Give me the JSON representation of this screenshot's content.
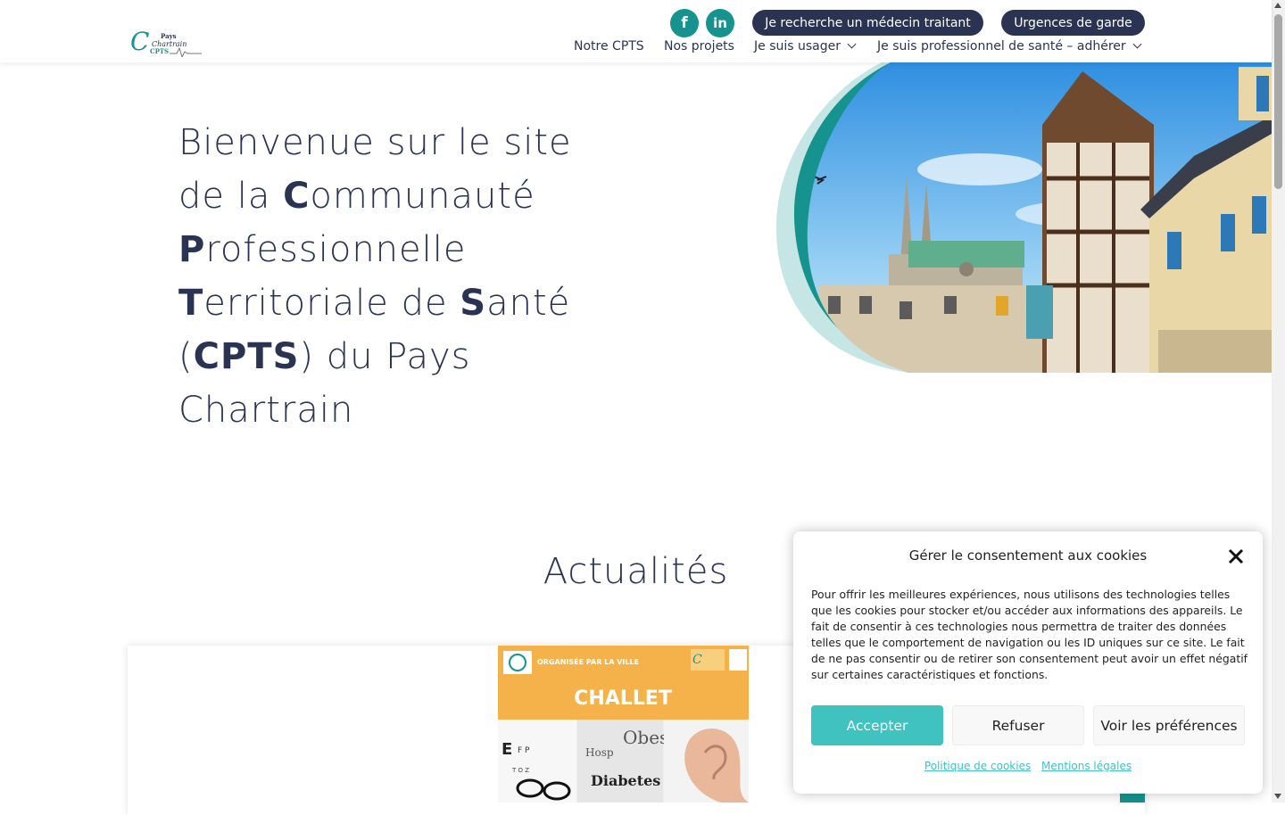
{
  "header": {
    "logo": {
      "text_top": "Pays",
      "text_mid": "Chartrain",
      "text_letters": "CPTS"
    },
    "social": [
      {
        "icon": "facebook-icon",
        "glyph": "f"
      },
      {
        "icon": "linkedin-icon",
        "glyph": "in"
      }
    ],
    "cta": {
      "medecin": "Je recherche un médecin traitant",
      "urgences": "Urgences de garde"
    },
    "nav": {
      "notre": "Notre CPTS",
      "projets": "Nos projets",
      "usager": "Je suis usager",
      "pro": "Je suis professionnel de santé – adhérer"
    }
  },
  "hero": {
    "line1": "Bienvenue sur le site",
    "l2a": "de la ",
    "l2b": "C",
    "l2c": "ommunauté",
    "l3a": "P",
    "l3b": "rofessionnelle",
    "l4a": "T",
    "l4b": "erritoriale de ",
    "l4c": "S",
    "l4d": "anté",
    "l5a": "(",
    "l5b": "CPTS",
    "l5c": ") du Pays",
    "line6": "Chartrain"
  },
  "news": {
    "title": "Actualités",
    "poster": {
      "top": "ORGANISÉE PAR LA VILLE",
      "city": "CHALLET",
      "word1": "Obes",
      "word2": "Hosp",
      "word3": "Diabetes"
    }
  },
  "cookie": {
    "title": "Gérer le consentement aux cookies",
    "text": "Pour offrir les meilleures expériences, nous utilisons des technologies telles que les cookies pour stocker et/ou accéder aux informations des appareils. Le fait de consentir à ces technologies nous permettra de traiter des données telles que le comportement de navigation ou les ID uniques sur ce site. Le fait de ne pas consentir ou de retirer son consentement peut avoir un effet négatif sur certaines caractéristiques et fonctions.",
    "accept": "Accepter",
    "refuse": "Refuser",
    "prefs": "Voir les préférences",
    "policy": "Politique de cookies",
    "legal": "Mentions légales"
  },
  "colors": {
    "navy": "#2a3452",
    "teal": "#16938f",
    "accent": "#3fc2c0",
    "poster_orange": "#f6b24a"
  }
}
